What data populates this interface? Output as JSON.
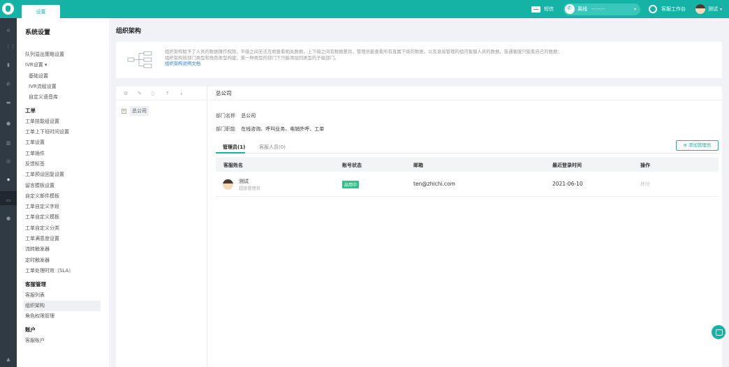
{
  "topbar": {
    "tab_label": "设置",
    "sms_label": "短信",
    "status_label": "离线",
    "status_timer": "--:--:--",
    "workbench_label": "客服工作台",
    "user_name": "测试"
  },
  "sidebar": {
    "title": "系统设置",
    "items": [
      {
        "label": "队列溢出策略设置",
        "type": "item"
      },
      {
        "label": "IVR设置 ▾",
        "type": "item"
      },
      {
        "label": "基础设置",
        "type": "indent"
      },
      {
        "label": "IVR流程设置",
        "type": "indent"
      },
      {
        "label": "自定义语音库",
        "type": "indent"
      },
      {
        "label": "工单",
        "type": "head"
      },
      {
        "label": "工单技能组设置",
        "type": "item"
      },
      {
        "label": "工单上下班时间设置",
        "type": "item"
      },
      {
        "label": "工单设置",
        "type": "item"
      },
      {
        "label": "工单插件",
        "type": "item"
      },
      {
        "label": "反馈标签",
        "type": "item"
      },
      {
        "label": "工单预设回复设置",
        "type": "item"
      },
      {
        "label": "留言模板设置",
        "type": "item"
      },
      {
        "label": "自定义邮件模板",
        "type": "item"
      },
      {
        "label": "工单自定义字段",
        "type": "item"
      },
      {
        "label": "工单自定义模板",
        "type": "item"
      },
      {
        "label": "工单自定义分类",
        "type": "item"
      },
      {
        "label": "工单满意度设置",
        "type": "item"
      },
      {
        "label": "流转触发器",
        "type": "item"
      },
      {
        "label": "定时触发器",
        "type": "item"
      },
      {
        "label": "工单处理时效（SLA）",
        "type": "item"
      },
      {
        "label": "客服管理",
        "type": "head"
      },
      {
        "label": "客服列表",
        "type": "item"
      },
      {
        "label": "组织架构",
        "type": "active"
      },
      {
        "label": "角色权限管理",
        "type": "item"
      },
      {
        "label": "账户",
        "type": "head"
      },
      {
        "label": "客服账户",
        "type": "item"
      }
    ]
  },
  "page": {
    "title": "组织架构"
  },
  "info": {
    "line1": "组织架构赋予了人员的数据操作权限，平级之间无法互相查看相关数据，上下级之间有数据差异，管理员能查看所有直属下级的数据，以及直接管理的组内客服人员的数据，普通客服只能看自己的数据；",
    "line2": "组织架构按部门类型和角色类型构建，某一种类型的部门下只能添加同类型的子级部门。",
    "link": "组织架构说明文档"
  },
  "tree": {
    "root": "总公司"
  },
  "detail": {
    "title": "总公司",
    "dept_name_key": "部门名称",
    "dept_name_val": "总公司",
    "dept_func_key": "部门职能",
    "dept_func_val": "在线咨询、呼叫业务、电销外呼、工单",
    "tab_admins": "管理员(1)",
    "tab_agents": "客服人员(0)",
    "add_admin": "添加管理员",
    "columns": [
      "客服姓名",
      "账号状态",
      "邮箱",
      "最近登录时间",
      "操作"
    ],
    "rows": [
      {
        "name": "测试",
        "role": "超级管理员",
        "status": "启用中",
        "email": "ten@zhichi.com",
        "last_login": "2021-06-10",
        "action": "移除"
      }
    ]
  },
  "colors": {
    "brand": "#15b3a6",
    "badge": "#2ec28a",
    "link": "#2e7de0"
  }
}
